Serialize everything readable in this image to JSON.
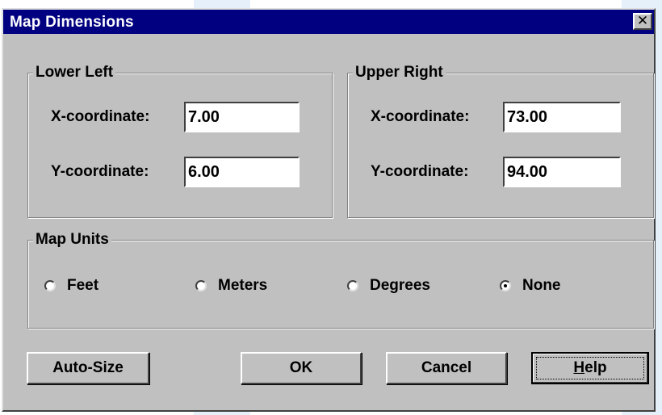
{
  "window": {
    "title": "Map Dimensions",
    "close_symbol": "✕"
  },
  "lower_left": {
    "legend": "Lower Left",
    "x_label": "X-coordinate:",
    "x_value": "7.00",
    "y_label": "Y-coordinate:",
    "y_value": "6.00"
  },
  "upper_right": {
    "legend": "Upper Right",
    "x_label": "X-coordinate:",
    "x_value": "73.00",
    "y_label": "Y-coordinate:",
    "y_value": "94.00"
  },
  "map_units": {
    "legend": "Map Units",
    "options": [
      {
        "label": "Feet",
        "selected": false
      },
      {
        "label": "Meters",
        "selected": false
      },
      {
        "label": "Degrees",
        "selected": false
      },
      {
        "label": "None",
        "selected": true
      }
    ]
  },
  "buttons": {
    "auto_size": "Auto-Size",
    "ok": "OK",
    "cancel": "Cancel",
    "help_accel": "H",
    "help_rest": "elp"
  },
  "colors": {
    "titlebar": "#000080",
    "face": "#c0c0c0"
  }
}
